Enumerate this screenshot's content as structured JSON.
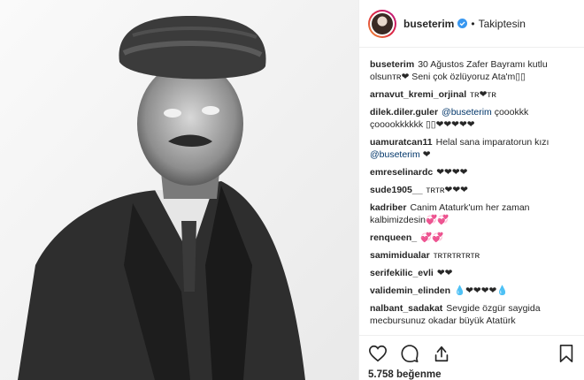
{
  "header": {
    "username": "buseterim",
    "separator": "•",
    "follow_status": "Takiptesin"
  },
  "caption": {
    "user": "buseterim",
    "text": "30 Ağustos Zafer Bayramı kutlu olsunᴛʀ❤ Seni çok özlüyoruz Ata'm▯▯"
  },
  "comments": [
    {
      "user": "arnavut_kremi_orjinal",
      "text": "ᴛʀ❤ᴛʀ"
    },
    {
      "user": "dilek.diler.guler",
      "mention": "@buseterim",
      "text": "çoookkk çooookkkkkk ▯▯❤❤❤❤❤"
    },
    {
      "user": "uamuratcan11",
      "text": "Helal sana imparatorun kızı",
      "mention2": "@buseterim",
      "text2": "❤"
    },
    {
      "user": "emreselinardc",
      "text": "❤❤❤❤"
    },
    {
      "user": "sude1905__",
      "text": "ᴛʀᴛʀ❤❤❤"
    },
    {
      "user": "kadriber",
      "text": "Canim Ataturk'um her zaman kalbimizdesin💞💞"
    },
    {
      "user": "renqueen_",
      "text": "💞💞"
    },
    {
      "user": "samimidualar",
      "text": "ᴛʀᴛʀᴛʀᴛʀᴛʀ"
    },
    {
      "user": "serifekilic_evli",
      "text": "❤❤"
    },
    {
      "user": "validemin_elinden",
      "text": "💧❤❤❤❤💧"
    },
    {
      "user": "nalbant_sadakat",
      "text": "Sevgide özgür saygida mecbursunuz okadar büyük Atatürk"
    }
  ],
  "likes": "5.758 beğenme",
  "colors": {
    "verified": "#3897f0",
    "link": "#003569",
    "text": "#262626",
    "border": "#efefef"
  },
  "icons": [
    "heart-icon",
    "comment-icon",
    "share-icon",
    "bookmark-icon",
    "verified-badge-icon"
  ]
}
